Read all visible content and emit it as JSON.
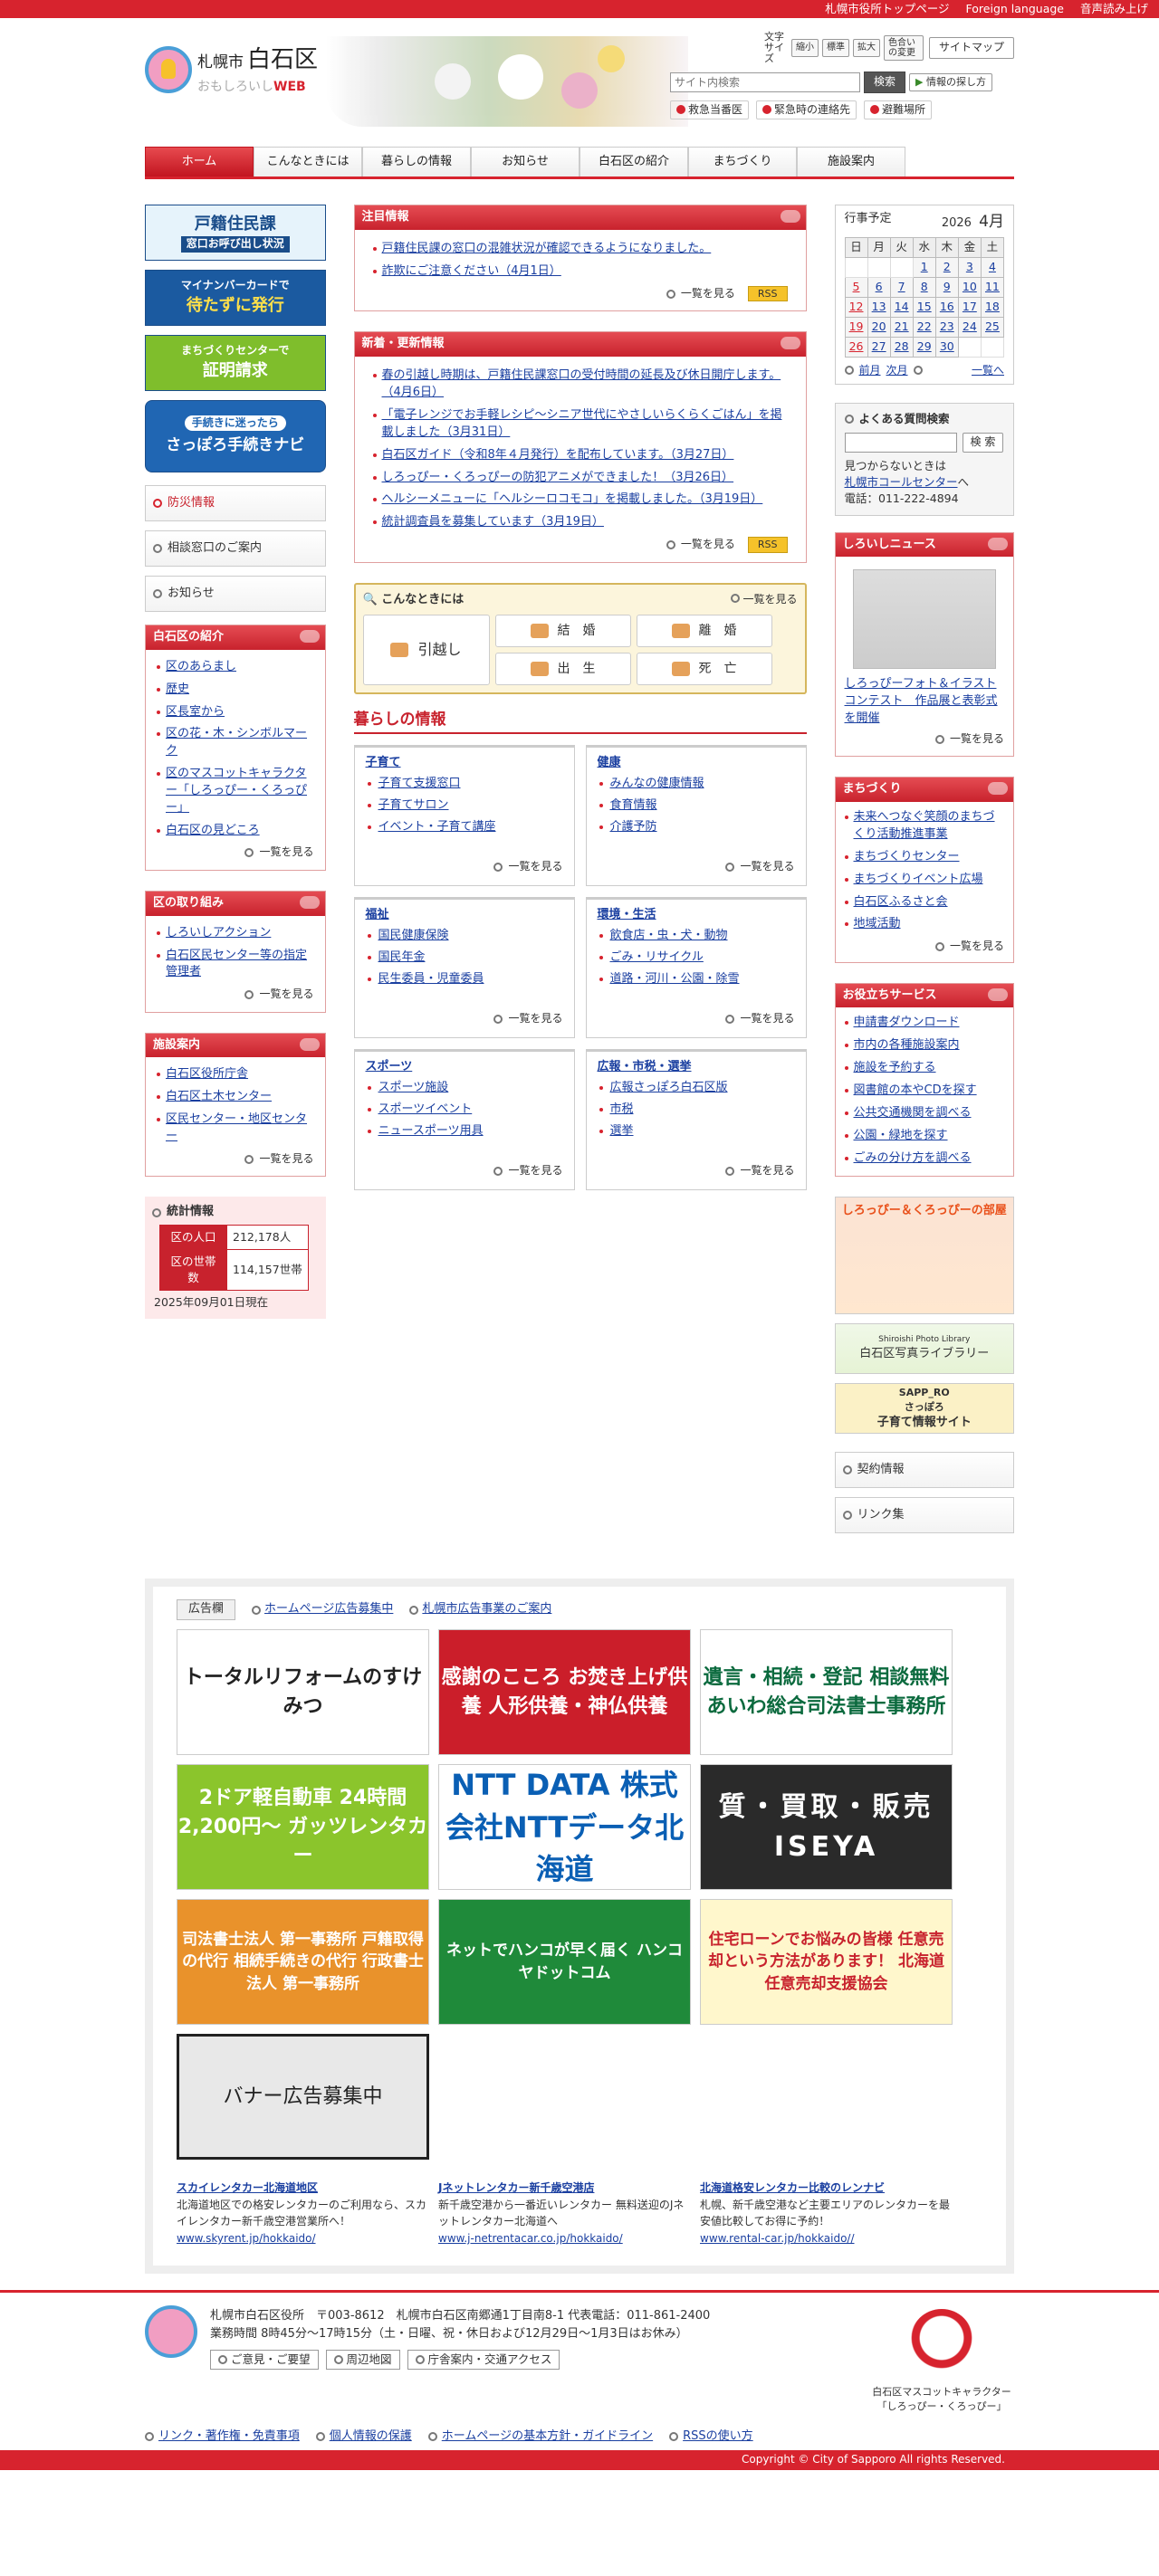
{
  "topbar": {
    "links": [
      "札幌市役所トップページ",
      "Foreign language",
      "音声読み上げ"
    ]
  },
  "header": {
    "logo_city": "札幌市",
    "logo_ward": "白石区",
    "logo_sub": "おもしろいし",
    "logo_web": "WEB",
    "font_label": "文字サイズ",
    "font_buttons": [
      "縮小",
      "標準",
      "拡大"
    ],
    "color_button": "色合いの変更",
    "sitemap": "サイトマップ",
    "search_placeholder": "サイト内検索",
    "search_button": "検索",
    "find_info": "情報の探し方",
    "emergency": [
      "救急当番医",
      "緊急時の連絡先",
      "避難場所"
    ]
  },
  "gnav": [
    "ホーム",
    "こんなときには",
    "暮らしの情報",
    "お知らせ",
    "白石区の紹介",
    "まちづくり",
    "施設案内"
  ],
  "left": {
    "banners": [
      {
        "line1": "戸籍住民課",
        "line2": "窓口お呼び出し状況"
      },
      {
        "line1": "マイナンバーカードで",
        "line2": "待たずに発行"
      },
      {
        "line1": "まちづくりセンターで",
        "line2": "証明請求"
      },
      {
        "line1": "手続きに迷ったら",
        "line2": "さっぽろ手続きナビ"
      }
    ],
    "menu": [
      "防災情報",
      "相談窓口のご案内",
      "お知らせ"
    ],
    "intro": {
      "title": "白石区の紹介",
      "items": [
        "区のあらまし",
        "歴史",
        "区長室から",
        "区の花・木・シンボルマーク",
        "区のマスコットキャラクター「しろっぴー・くろっぴー」",
        "白石区の見どころ"
      ],
      "more": "一覧を見る"
    },
    "torikumi": {
      "title": "区の取り組み",
      "items": [
        "しろいしアクション",
        "白石区民センター等の指定管理者"
      ],
      "more": "一覧を見る"
    },
    "shisetsu": {
      "title": "施設案内",
      "items": [
        "白石区役所庁舎",
        "白石区土木センター",
        "区民センター・地区センター"
      ],
      "more": "一覧を見る"
    },
    "stats": {
      "title": "統計情報",
      "pop_label": "区の人口",
      "pop_value": "212,178人",
      "hh_label": "区の世帯数",
      "hh_value": "114,157世帯",
      "as_of": "2025年09月01日現在"
    }
  },
  "main": {
    "chumoku": {
      "title": "注目情報",
      "items": [
        "戸籍住民課の窓口の混雑状況が確認できるようになりました。",
        "詐欺にご注意ください（4月1日）"
      ],
      "more": "一覧を見る",
      "rss": "RSS"
    },
    "shinchaku": {
      "title": "新着・更新情報",
      "items": [
        "春の引越し時期は、戸籍住民課窓口の受付時間の延長及び休日開庁します。（4月6日）",
        "「電子レンジでお手軽レシピ～シニア世代にやさしいらくらくごはん」を掲載しました（3月31日）",
        "白石区ガイド（令和8年４月発行）を配布しています。（3月27日）",
        "しろっぴー・くろっぴーの防犯アニメができました！（3月26日）",
        "ヘルシーメニューに「ヘルシーロコモコ」を掲載しました。（3月19日）",
        "統計調査員を募集しています（3月19日）"
      ],
      "more": "一覧を見る",
      "rss": "RSS"
    },
    "konna": {
      "title": "こんなときには",
      "more": "一覧を見る",
      "buttons": [
        "引越し",
        "結　婚",
        "離　婚",
        "出　生",
        "死　亡"
      ]
    },
    "kurashi": {
      "title": "暮らしの情報",
      "boxes": [
        {
          "title": "子育て",
          "items": [
            "子育て支援窓口",
            "子育てサロン",
            "イベント・子育て講座"
          ]
        },
        {
          "title": "健康",
          "items": [
            "みんなの健康情報",
            "食育情報",
            "介護予防"
          ]
        },
        {
          "title": "福祉",
          "items": [
            "国民健康保険",
            "国民年金",
            "民生委員・児童委員"
          ]
        },
        {
          "title": "環境・生活",
          "items": [
            "飲食店・虫・犬・動物",
            "ごみ・リサイクル",
            "道路・河川・公園・除雪"
          ]
        },
        {
          "title": "スポーツ",
          "items": [
            "スポーツ施設",
            "スポーツイベント",
            "ニュースポーツ用具"
          ]
        },
        {
          "title": "広報・市税・選挙",
          "items": [
            "広報さっぽろ白石区版",
            "市税",
            "選挙"
          ]
        }
      ],
      "more": "一覧を見る"
    }
  },
  "right": {
    "calendar": {
      "label": "行事予定",
      "year": "2026",
      "month": "4月",
      "weekdays": [
        "日",
        "月",
        "火",
        "水",
        "木",
        "金",
        "土"
      ],
      "rows": [
        [
          "",
          "",
          "",
          "1",
          "2",
          "3",
          "4"
        ],
        [
          "5",
          "6",
          "7",
          "8",
          "9",
          "10",
          "11"
        ],
        [
          "12",
          "13",
          "14",
          "15",
          "16",
          "17",
          "18"
        ],
        [
          "19",
          "20",
          "21",
          "22",
          "23",
          "24",
          "25"
        ],
        [
          "26",
          "27",
          "28",
          "29",
          "30",
          "",
          ""
        ]
      ],
      "prev": "前月",
      "next": "次月",
      "list": "一覧へ"
    },
    "faq": {
      "title": "よくある質問検索",
      "button": "検 索",
      "note": "見つからないときは",
      "link": "札幌市コールセンター",
      "note2": "へ",
      "tel": "電話：011-222-4894"
    },
    "news": {
      "title": "しろいしニュース",
      "caption": "しろっぴーフォト＆イラストコンテスト　作品展と表彰式を開催",
      "more": "一覧を見る"
    },
    "machi": {
      "title": "まちづくり",
      "items": [
        "未来へつなぐ笑顔のまちづくり活動推進事業",
        "まちづくりセンター",
        "まちづくりイベント広場",
        "白石区ふるさと会",
        "地域活動"
      ],
      "more": "一覧を見る"
    },
    "service": {
      "title": "お役立ちサービス",
      "items": [
        "申請書ダウンロード",
        "市内の各種施設案内",
        "施設を予約する",
        "図書館の本やCDを探す",
        "公共交通機関を調べる",
        "公園・緑地を探す",
        "ごみの分け方を調べる"
      ]
    },
    "banners": {
      "b1": "しろっぴー＆くろっぴーの部屋",
      "b2a": "Shiroishi Photo Library",
      "b2b": "白石区写真ライブラリー",
      "b3a": "SAPP_RO",
      "b3b": "さっぽろ",
      "b3c": "子育て情報サイト"
    },
    "menu": [
      "契約情報",
      "リンク集"
    ]
  },
  "ads": {
    "label": "広告欄",
    "links": [
      "ホームページ広告募集中",
      "札幌市広告事業のご案内"
    ],
    "banners": [
      "トータルリフォームのすけみつ",
      "感謝のこころ お焚き上げ供養 人形供養・神仏供養",
      "遺言・相続・登記 相談無料 あいわ総合司法書士事務所",
      "2ドア軽自動車 24時間 2,200円～ ガッツレンタカー",
      "NTT DATA 株式会社NTTデータ北海道",
      "質・買取・販売 ISEYA",
      "司法書士法人 第一事務所 戸籍取得の代行 相続手続きの代行 行政書士法人 第一事務所",
      "ネットでハンコが早く届く ハンコヤドットコム",
      "住宅ローンでお悩みの皆様 任意売却という方法があります！ 北海道任意売却支援協会",
      "バナー広告募集中"
    ],
    "text_ads": [
      {
        "title": "スカイレンタカー北海道地区",
        "body": "北海道地区での格安レンタカーのご利用なら、スカイレンタカー新千歳空港営業所へ！",
        "url": "www.skyrent.jp/hokkaido/"
      },
      {
        "title": "Jネットレンタカー新千歳空港店",
        "body": "新千歳空港から一番近いレンタカー 無料送迎のJネットレンタカー北海道へ",
        "url": "www.j-netrentacar.co.jp/hokkaido/"
      },
      {
        "title": "北海道格安レンタカー比較のレンナビ",
        "body": "札幌、新千歳空港など主要エリアのレンタカーを最安値比較してお得に予約！",
        "url": "www.rental-car.jp/hokkaido//"
      }
    ]
  },
  "footer": {
    "line1": "札幌市白石区役所　〒003-8612　札幌市白石区南郷通1丁目南8-1 代表電話：011-861-2400",
    "line2": "業務時間 8時45分～17時15分（土・日曜、祝・休日および12月29日～1月3日はお休み）",
    "buttons": [
      "ご意見・ご要望",
      "周辺地図",
      "庁舎案内・交通アクセス"
    ],
    "mascot1": "白石区マスコットキャラクター",
    "mascot2": "「しろっぴー・くろっぴー」",
    "links": [
      "リンク・著作権・免責事項",
      "個人情報の保護",
      "ホームページの基本方針・ガイドライン",
      "RSSの使い方"
    ],
    "copyright": "Copyright © City of Sapporo All rights Reserved."
  }
}
